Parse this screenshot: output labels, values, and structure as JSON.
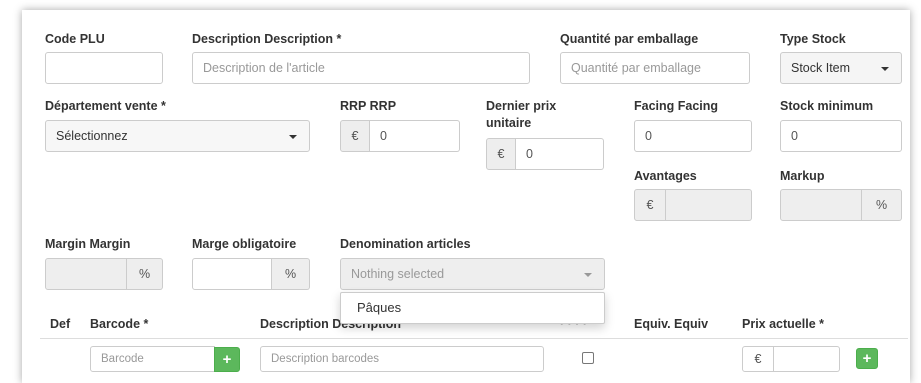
{
  "form": {
    "code_plu": {
      "label": "Code PLU",
      "value": ""
    },
    "description": {
      "label": "Description Description *",
      "placeholder": "Description de l'article"
    },
    "quantite": {
      "label": "Quantité par emballage",
      "placeholder": "Quantité par emballage"
    },
    "type_stock": {
      "label": "Type Stock",
      "selected": "Stock Item"
    },
    "departement": {
      "label": "Département vente *",
      "selected": "Sélectionnez"
    },
    "rrp": {
      "label": "RRP RRP",
      "currency": "€",
      "value": "0"
    },
    "dernier_prix": {
      "label_line1": "Dernier prix",
      "label_line2": "unitaire",
      "currency": "€",
      "value": "0"
    },
    "facing": {
      "label": "Facing Facing",
      "value": "0"
    },
    "stock_minimum": {
      "label": "Stock minimum",
      "value": "0"
    },
    "avantages": {
      "label": "Avantages",
      "currency": "€",
      "value": ""
    },
    "markup": {
      "label": "Markup",
      "suffix": "%",
      "value": ""
    },
    "margin": {
      "label": "Margin Margin",
      "suffix": "%",
      "value": ""
    },
    "marge_obligatoire": {
      "label": "Marge obligatoire",
      "suffix": "%",
      "value": ""
    },
    "denomination": {
      "label": "Denomination articles",
      "placeholder": "Nothing selected",
      "options": [
        "Pâques"
      ]
    }
  },
  "barcode_table": {
    "headers": {
      "def": "Def",
      "barcode": "Barcode *",
      "description": "Description Description",
      "equiv": "Equiv. Equiv",
      "prix": "Prix actuelle *"
    },
    "row": {
      "barcode_placeholder": "Barcode",
      "description_placeholder": "Description barcodes",
      "currency": "€",
      "add_label": "+"
    }
  },
  "colors": {
    "accent_green": "#5cb85c",
    "border": "#cccccc",
    "disabled_bg": "#eeeeee"
  }
}
